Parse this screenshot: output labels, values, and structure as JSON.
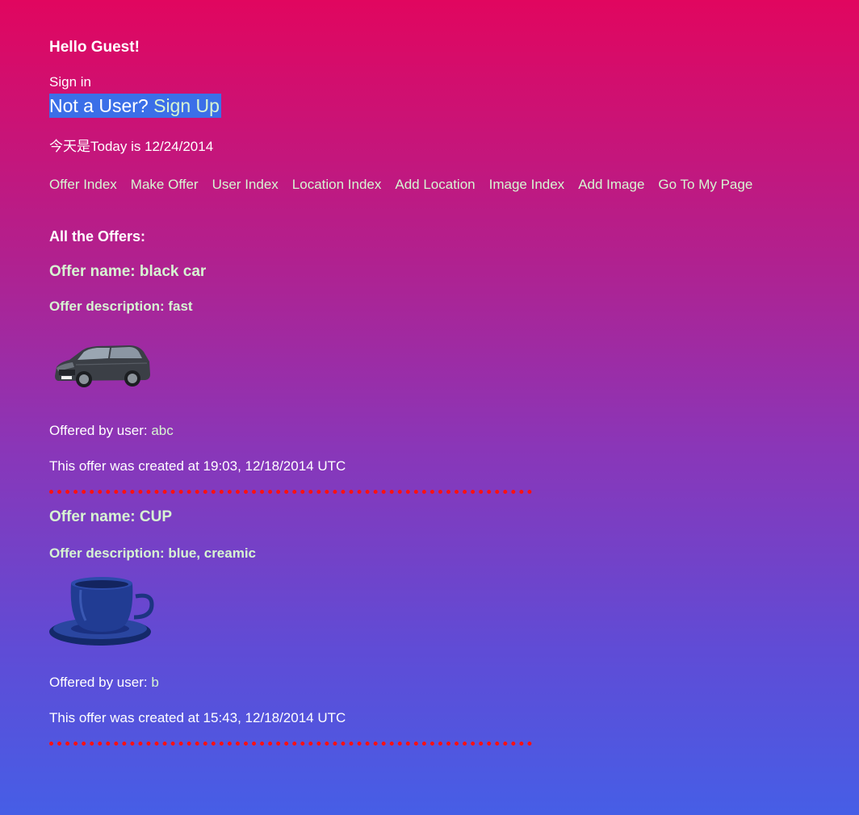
{
  "greeting": "Hello Guest!",
  "sign_in": "Sign in",
  "signup_prompt": "Not a User?",
  "signup_link": "Sign Up",
  "today": "今天是Today is 12/24/2014",
  "nav": [
    "Offer Index",
    "Make Offer",
    "User Index",
    "Location Index",
    "Add Location",
    "Image Index",
    "Add Image",
    "Go To My Page"
  ],
  "all_offers_heading": "All the Offers:",
  "offers": [
    {
      "name": "Offer name: black car",
      "description": "Offer description: fast",
      "image_icon": "black-car-icon",
      "offered_by_label": "Offered by user:",
      "user": "abc",
      "created": "This offer was created at 19:03, 12/18/2014 UTC"
    },
    {
      "name": "Offer name: CUP",
      "description": "Offer description: blue, creamic",
      "image_icon": "blue-cup-icon",
      "offered_by_label": "Offered by user:",
      "user": "b",
      "created": "This offer was created at 15:43, 12/18/2014 UTC"
    }
  ],
  "colors": {
    "gradient_top": "#e1065f",
    "gradient_bottom": "#465ee6",
    "link": "#d7f5d2",
    "signup_highlight": "#3b6fe8",
    "divider": "#ff1010"
  }
}
